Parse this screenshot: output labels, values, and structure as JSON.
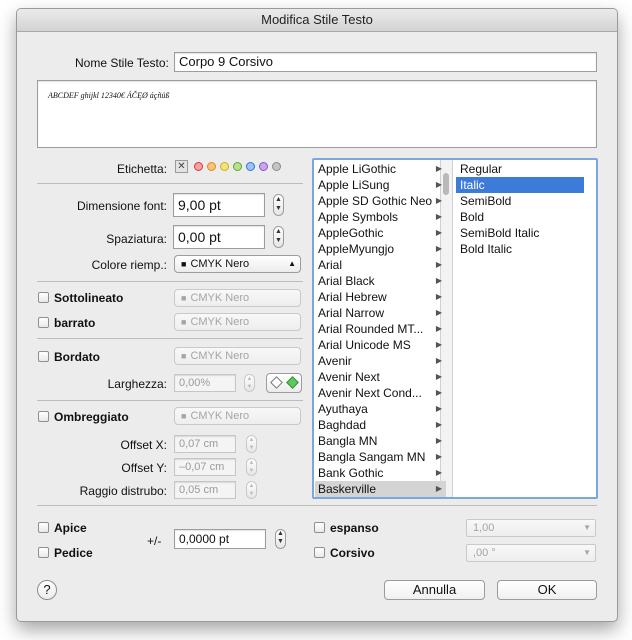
{
  "window": {
    "title": "Modifica Stile Testo"
  },
  "name": {
    "label": "Nome Stile Testo:",
    "value": "Corpo 9 Corsivo"
  },
  "preview": {
    "text": "ABCDEF ghijkl 12340€ ÁČĘØ áçñüß"
  },
  "label_section": {
    "label": "Etichetta:",
    "clear_glyph": "✕",
    "colors": [
      "#f7a0a0",
      "#f9c27a",
      "#f4e27c",
      "#b6e08a",
      "#9fc4f3",
      "#c8a6ee",
      "#c4c4c4"
    ],
    "color_borders": [
      "#d23b3b",
      "#e08a1f",
      "#c9b21a",
      "#5aa834",
      "#3474d6",
      "#8b52cc",
      "#8a8a8a"
    ]
  },
  "font_size": {
    "label": "Dimensione font:",
    "value": "9,00 pt"
  },
  "spacing": {
    "label": "Spaziatura:",
    "value": "0,00 pt"
  },
  "fill_color": {
    "label": "Colore riemp.:",
    "value": "CMYK Nero",
    "swatch": "■"
  },
  "underline": {
    "label": "Sottolineato",
    "color": "CMYK Nero"
  },
  "strike": {
    "label": "barrato",
    "color": "CMYK Nero"
  },
  "outline": {
    "label": "Bordato",
    "color": "CMYK Nero",
    "width_label": "Larghezza:",
    "width_value": "0,00%"
  },
  "shadow": {
    "label": "Ombreggiato",
    "color": "CMYK Nero",
    "offset_x_label": "Offset X:",
    "offset_x": "0,07 cm",
    "offset_y_label": "Offset Y:",
    "offset_y": "–0,07 cm",
    "blur_label": "Raggio distrubo:",
    "blur": "0,05 cm"
  },
  "font_list": {
    "fonts": [
      "Apple LiGothic",
      "Apple LiSung",
      "Apple SD Gothic Neo",
      "Apple Symbols",
      "AppleGothic",
      "AppleMyungjo",
      "Arial",
      "Arial Black",
      "Arial Hebrew",
      "Arial Narrow",
      "Arial Rounded MT...",
      "Arial Unicode MS",
      "Avenir",
      "Avenir Next",
      "Avenir Next Cond...",
      "Ayuthaya",
      "Baghdad",
      "Bangla MN",
      "Bangla Sangam MN",
      "Bank Gothic",
      "Baskerville"
    ],
    "selected_font": "Baskerville",
    "submenu_arrow": "▶",
    "styles": [
      "Regular",
      "Italic",
      "SemiBold",
      "Bold",
      "SemiBold Italic",
      "Bold Italic"
    ],
    "selected_style": "Italic",
    "selection_color": "#3d7bd8"
  },
  "superscript": {
    "label": "Apice"
  },
  "subscript": {
    "label": "Pedice"
  },
  "baseline": {
    "label": "+/-",
    "value": "0,0000 pt"
  },
  "expanded": {
    "label": "espanso",
    "value": "1,00"
  },
  "italic": {
    "label": "Corsivo",
    "value": ",00 °"
  },
  "footer": {
    "help": "?",
    "cancel": "Annulla",
    "ok": "OK"
  }
}
